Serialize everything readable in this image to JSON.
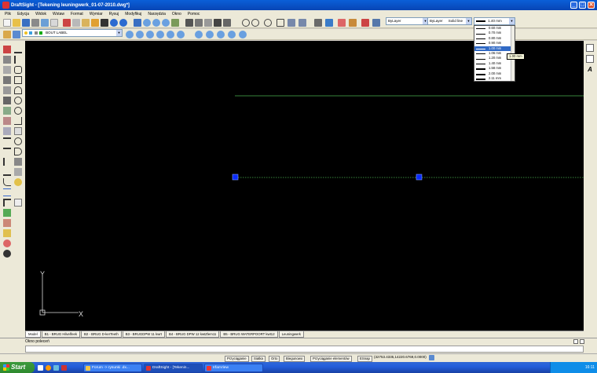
{
  "window": {
    "title": "DraftSight - [Tekening leuningwerk_01-07-2010.dwg*]",
    "controls": [
      "_",
      "□",
      "✕"
    ]
  },
  "menu": {
    "items": [
      "Plik",
      "Edycja",
      "Widok",
      "Wstaw",
      "Format",
      "Wymiar",
      "Rysuj",
      "Modyfikuj",
      "Narzędzia",
      "Okno",
      "Pomoc"
    ]
  },
  "toolbar": {
    "layer_value": "BOUT LABEL",
    "color_value": "ByLayer",
    "linetype_layer": "ByLayer",
    "linetype_value": "Solid line",
    "lineweight_value": "1.40 mm"
  },
  "lineweight_dropdown": {
    "options": [
      "0.60 mm",
      "0.70 mm",
      "0.80 mm",
      "0.90 mm",
      "1.00 mm",
      "1.06 mm",
      "1.20 mm",
      "1.40 mm",
      "1.58 mm",
      "2.00 mm",
      "2.11 mm"
    ],
    "selected_index": 4,
    "tooltip": "1.00 mm"
  },
  "canvas": {
    "background": "#000000",
    "ucs_x_label": "X",
    "ucs_y_label": "Y"
  },
  "tabs": [
    "Model",
    "B1 - BRUG Hilvelfeek",
    "B2 - BRUG D-kerTeeth",
    "B3 - BRUGDPW 11 kwrt",
    "B4 - BRUG DPW 12 kwtZlem11",
    "B5 - BRUG WATERPOORT kwt12",
    "Leuningwerk"
  ],
  "command_window": {
    "title": "Okno poleceń"
  },
  "statusbar": {
    "buttons": [
      "Przyciąganie",
      "Siatka",
      "Orto",
      "Biegunowo",
      "Przyciąganie elementów",
      "ESnap"
    ],
    "coordinates": "(32753.4335,14220.6769,0.0000)"
  },
  "taskbar": {
    "start_label": "Start",
    "items": [
      "Forum -> rysunki .dx...",
      "DraftSight - [Tekenin...",
      "IrfanView"
    ],
    "clock": "16:11"
  }
}
